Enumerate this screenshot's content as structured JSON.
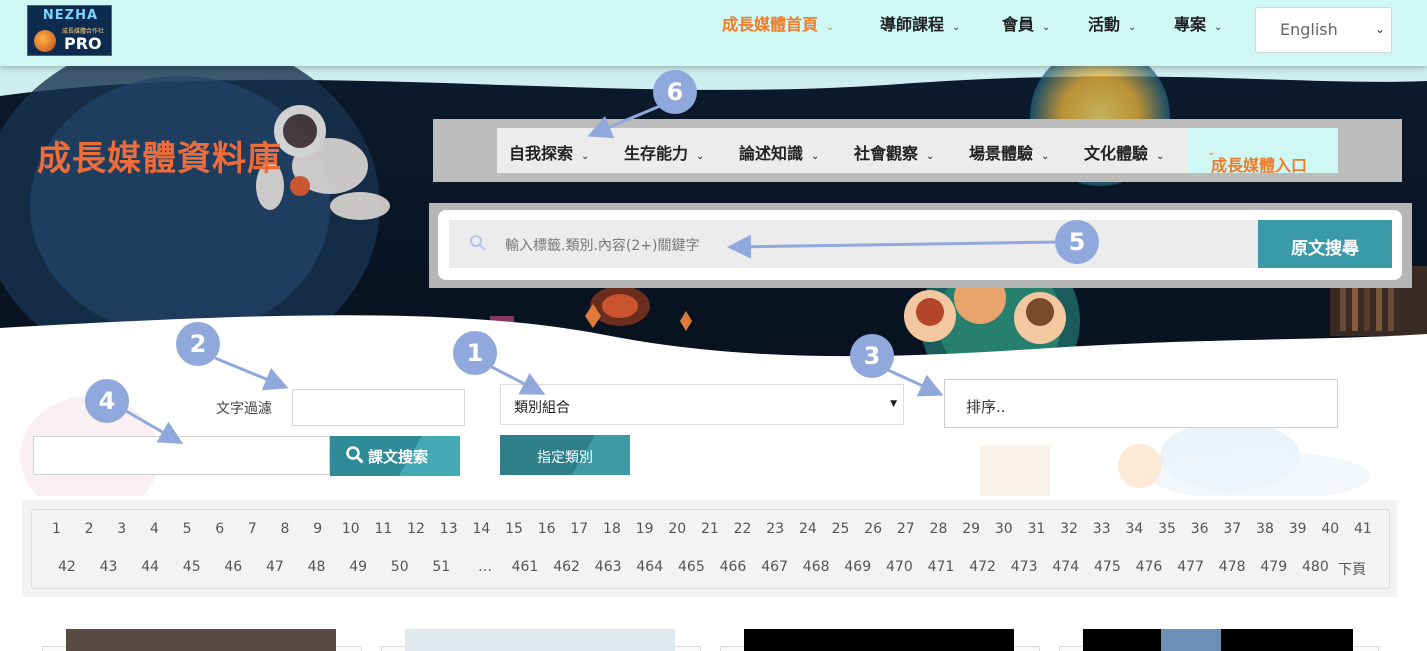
{
  "logo": {
    "line1": "NEZHA",
    "line2": "PRO",
    "tagline": "成長媒體合作社"
  },
  "topnav": {
    "items": [
      {
        "label": "成長媒體首頁",
        "active": true
      },
      {
        "label": "導師課程",
        "active": false
      },
      {
        "label": "會員",
        "active": false
      },
      {
        "label": "活動",
        "active": false
      },
      {
        "label": "專案",
        "active": false
      }
    ],
    "language": "English"
  },
  "banner": {
    "title": "成長媒體資料庫"
  },
  "categories": {
    "items": [
      "自我探索",
      "生存能力",
      "論述知識",
      "社會觀察",
      "場景體驗",
      "文化體驗"
    ],
    "entry": "成長媒體入口"
  },
  "search": {
    "placeholder": "輸入標籤.類別.內容(2+)關鍵字",
    "button": "原文搜尋"
  },
  "filters": {
    "text_filter_label": "文字過濾",
    "category_select": "類別組合",
    "sort_placeholder": "排序..",
    "lesson_search_button": "課文搜索",
    "assign_button": "指定類別"
  },
  "pagination": {
    "row1": [
      "1",
      "2",
      "3",
      "4",
      "5",
      "6",
      "7",
      "8",
      "9",
      "10",
      "11",
      "12",
      "13",
      "14",
      "15",
      "16",
      "17",
      "18",
      "19",
      "20",
      "21",
      "22",
      "23",
      "24",
      "25",
      "26",
      "27",
      "28",
      "29",
      "30",
      "31",
      "32",
      "33",
      "34",
      "35",
      "36",
      "37",
      "38",
      "39",
      "40",
      "41"
    ],
    "row2": [
      "42",
      "43",
      "44",
      "45",
      "46",
      "47",
      "48",
      "49",
      "50",
      "51",
      "…",
      "461",
      "462",
      "463",
      "464",
      "465",
      "466",
      "467",
      "468",
      "469",
      "470",
      "471",
      "472",
      "473",
      "474",
      "475",
      "476",
      "477",
      "478",
      "479",
      "480"
    ],
    "next": "下頁"
  },
  "annotations": [
    "1",
    "2",
    "3",
    "4",
    "5",
    "6"
  ],
  "colors": {
    "accent_orange": "#f07c2a",
    "teal": "#3b9aa8",
    "nav_bg": "#cff8f5",
    "marker": "#90a8dc"
  }
}
